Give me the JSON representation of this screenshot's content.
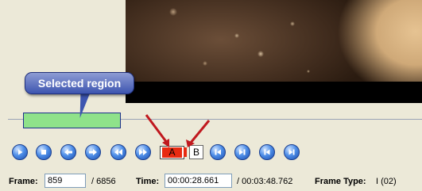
{
  "annotation": {
    "callout_text": "Selected region"
  },
  "transport": {
    "buttons": [
      {
        "icon": "play-icon"
      },
      {
        "icon": "stop-icon"
      },
      {
        "icon": "arrow-left-icon"
      },
      {
        "icon": "arrow-right-icon"
      },
      {
        "icon": "rewind-icon"
      },
      {
        "icon": "fast-forward-icon"
      },
      {
        "icon": "prev-keyframe-icon"
      },
      {
        "icon": "next-keyframe-icon"
      },
      {
        "icon": "go-start-icon"
      },
      {
        "icon": "go-end-icon"
      }
    ],
    "mark_a_label": "A",
    "mark_b_label": "B"
  },
  "info": {
    "frame_label": "Frame:",
    "frame_value": "859",
    "frame_total": "/ 6856",
    "time_label": "Time:",
    "time_value": "00:00:28.661",
    "time_total": "/ 00:03:48.762",
    "frame_type_label": "Frame Type:",
    "frame_type_value": "I (02)"
  },
  "colors": {
    "selection": "#8fe28a",
    "callout": "#3d55b0",
    "arrow": "#c0181e",
    "marker_a": "#e82a10"
  }
}
